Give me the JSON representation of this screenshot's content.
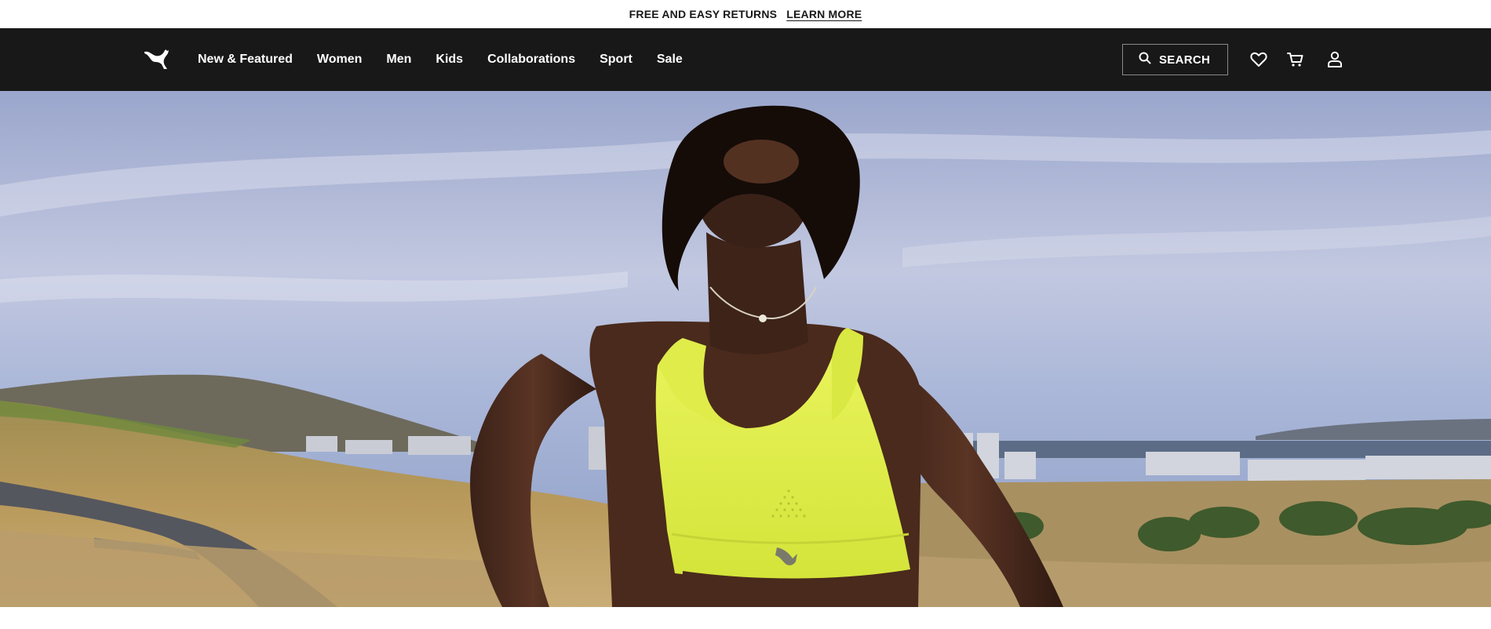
{
  "promo": {
    "text": "FREE AND EASY RETURNS",
    "link": "LEARN MORE"
  },
  "nav": {
    "logo_icon": "puma-cat-logo-icon",
    "items": [
      {
        "label": "New & Featured"
      },
      {
        "label": "Women"
      },
      {
        "label": "Men"
      },
      {
        "label": "Kids"
      },
      {
        "label": "Collaborations"
      },
      {
        "label": "Sport"
      },
      {
        "label": "Sale"
      }
    ],
    "search": {
      "label": "SEARCH",
      "icon": "search-icon"
    },
    "icons": [
      "heart-icon",
      "cart-icon",
      "user-icon"
    ]
  },
  "colors": {
    "nav_bg": "#181818",
    "accent_neon": "#e2f244"
  }
}
